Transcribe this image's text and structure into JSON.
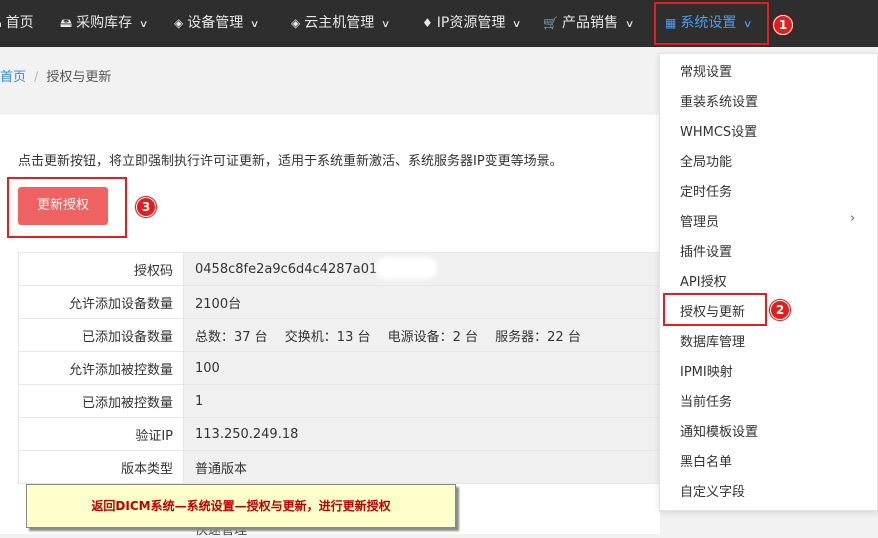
{
  "nav": {
    "items": [
      {
        "icon": "home-icon",
        "label": "首页"
      },
      {
        "icon": "cart-icon",
        "label": "采购库存"
      },
      {
        "icon": "cube-icon",
        "label": "设备管理"
      },
      {
        "icon": "cube-icon",
        "label": "云主机管理"
      },
      {
        "icon": "map-marker-icon",
        "label": "IP资源管理"
      },
      {
        "icon": "shopping-cart-icon",
        "label": "产品销售"
      },
      {
        "icon": "windows-grid-icon",
        "label": "系统设置"
      }
    ]
  },
  "markers": {
    "m1": "1",
    "m2": "2",
    "m3": "3"
  },
  "breadcrumb": {
    "home": "首页",
    "sep": "/",
    "current": "授权与更新"
  },
  "description": "点击更新按钮，将立即强制执行许可证更新，适用于系统重新激活、系统服务器IP变更等场景。",
  "update_button": "更新授权",
  "info_table": [
    {
      "key": "授权码",
      "value": "0458c8fe2a9c6d4c4287a0154"
    },
    {
      "key": "允许添加设备数量",
      "value": "2100台"
    },
    {
      "key": "已添加设备数量",
      "value": "总数：37 台　 交换机：13 台　 电源设备：2 台　 服务器：22 台"
    },
    {
      "key": "允许添加被控数量",
      "value": "100"
    },
    {
      "key": "已添加被控数量",
      "value": "1"
    },
    {
      "key": "验证IP",
      "value": "113.250.249.18"
    },
    {
      "key": "版本类型",
      "value": "普通版本"
    }
  ],
  "partial_row_text": "快速管理",
  "note": "返回DICM系统—系统设置—授权与更新，进行更新授权",
  "dropdown": {
    "items": [
      "常规设置",
      "重装系统设置",
      "WHMCS设置",
      "全局功能",
      "定时任务",
      "管理员",
      "插件设置",
      "API授权",
      "授权与更新",
      "数据库管理",
      "IPMI映射",
      "当前任务",
      "通知模板设置",
      "黑白名单",
      "自定义字段"
    ],
    "submenu_arrow": "›"
  },
  "colors": {
    "nav_bg": "#2e2e2e",
    "accent": "#4a9ff5",
    "button": "#ef6262",
    "marker": "#e02020",
    "note_bg": "#ffffcc"
  }
}
